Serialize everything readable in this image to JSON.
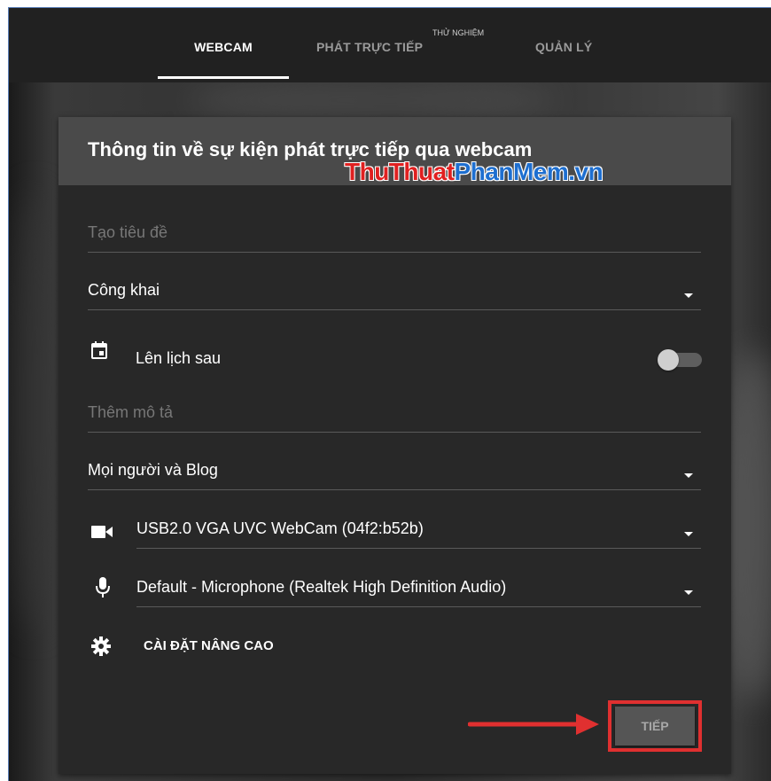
{
  "nav": {
    "tabs": [
      {
        "label": "WEBCAM",
        "active": true
      },
      {
        "label": "PHÁT TRỰC TIẾP",
        "badge": "THỬ NGHIỆM"
      },
      {
        "label": "QUẢN LÝ"
      }
    ]
  },
  "form": {
    "title": "Thông tin về sự kiện phát trực tiếp qua webcam",
    "watermark": {
      "part1": "ThuThuat",
      "part2": "PhanMem",
      "part3": ".vn"
    },
    "title_placeholder": "Tạo tiêu đề",
    "privacy_value": "Công khai",
    "schedule_label": "Lên lịch sau",
    "schedule_on": false,
    "description_placeholder": "Thêm mô tả",
    "category_value": "Mọi người và Blog",
    "camera_value": "USB2.0 VGA UVC WebCam (04f2:b52b)",
    "microphone_value": "Default - Microphone (Realtek High Definition Audio)",
    "advanced_settings_label": "CÀI ĐẶT NÂNG CAO",
    "next_button_label": "TIẾP"
  },
  "colors": {
    "highlight": "#e03030",
    "arrow": "#e03030",
    "watermark_red": "#e02020",
    "watermark_blue": "#1e6fd0"
  }
}
